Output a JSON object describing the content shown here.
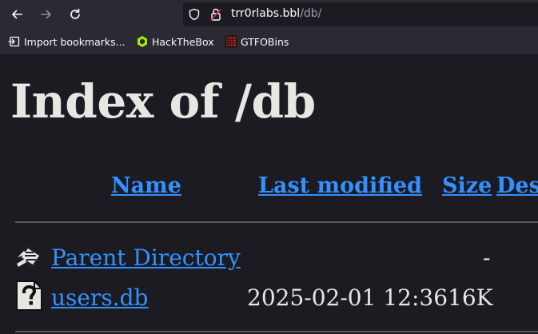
{
  "browser": {
    "url_host": "trr0rlabs.bbl",
    "url_path": "/db/"
  },
  "bookmarks": [
    {
      "label": "Import bookmarks...",
      "icon": "import-icon"
    },
    {
      "label": "HackTheBox",
      "icon": "hackthebox-icon"
    },
    {
      "label": "GTFOBins",
      "icon": "gtfobins-icon"
    }
  ],
  "page": {
    "title": "Index of /db",
    "columns": [
      "Name",
      "Last modified",
      "Size",
      "Des"
    ],
    "rows": [
      {
        "name": "Parent Directory",
        "modified": "",
        "size": "-",
        "icon": "back-icon"
      },
      {
        "name": "users.db",
        "modified": "2025-02-01 12:36",
        "size": "16K",
        "icon": "unknown-file-icon"
      }
    ]
  },
  "colors": {
    "link": "#3391ff",
    "text": "#e8e6e3",
    "background": "#1c1b22",
    "chrome": "#2b2a33"
  }
}
